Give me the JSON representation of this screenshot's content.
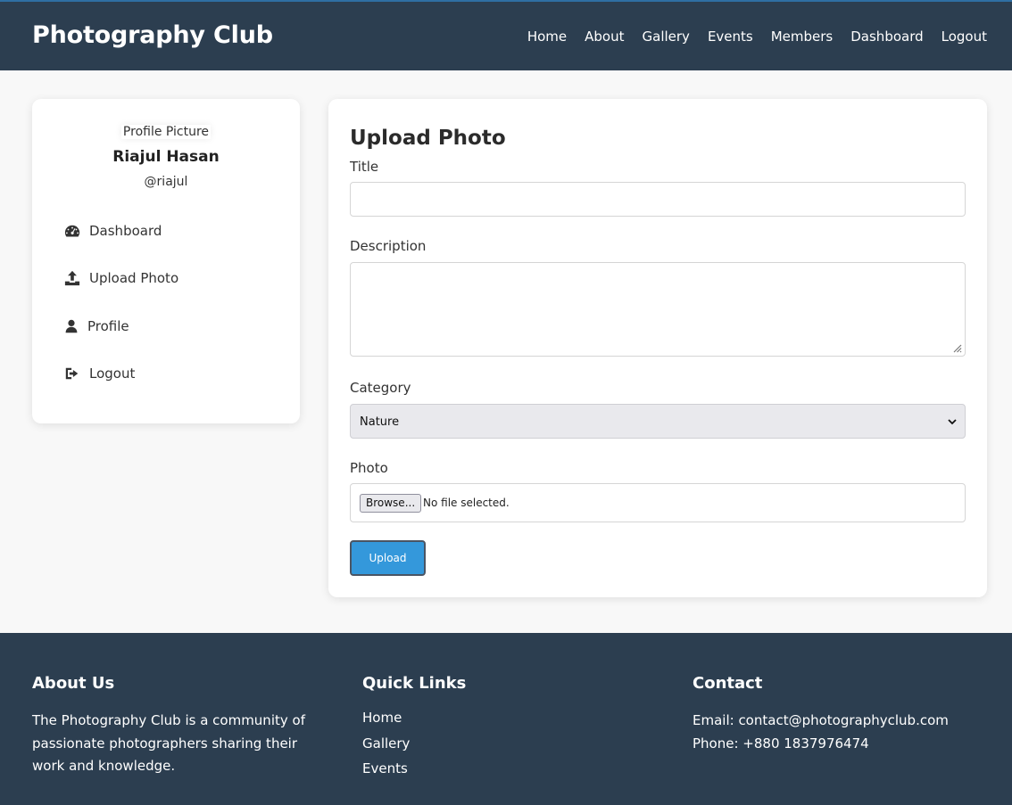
{
  "header": {
    "brand": "Photography Club",
    "nav": [
      "Home",
      "About",
      "Gallery",
      "Events",
      "Members",
      "Dashboard",
      "Logout"
    ]
  },
  "sidebar": {
    "profile_picture_alt": "Profile Picture",
    "name": "Riajul Hasan",
    "handle": "@riajul",
    "items": [
      {
        "label": "Dashboard",
        "icon": "tachometer-icon"
      },
      {
        "label": "Upload Photo",
        "icon": "upload-icon"
      },
      {
        "label": "Profile",
        "icon": "user-icon"
      },
      {
        "label": "Logout",
        "icon": "sign-out-icon"
      }
    ]
  },
  "form": {
    "heading": "Upload Photo",
    "title_label": "Title",
    "title_value": "",
    "description_label": "Description",
    "description_value": "",
    "category_label": "Category",
    "category_selected": "Nature",
    "photo_label": "Photo",
    "browse_label": "Browse...",
    "file_status": "No file selected.",
    "submit_label": "Upload"
  },
  "footer": {
    "about": {
      "heading": "About Us",
      "text": "The Photography Club is a community of passionate photographers sharing their work and knowledge."
    },
    "links": {
      "heading": "Quick Links",
      "items": [
        "Home",
        "Gallery",
        "Events"
      ]
    },
    "contact": {
      "heading": "Contact",
      "email": "Email: contact@photographyclub.com",
      "phone": "Phone: +880 1837976474"
    }
  },
  "colors": {
    "header_bg": "#2c3e50",
    "accent": "#3498db",
    "page_bg": "#f8f8f8"
  }
}
